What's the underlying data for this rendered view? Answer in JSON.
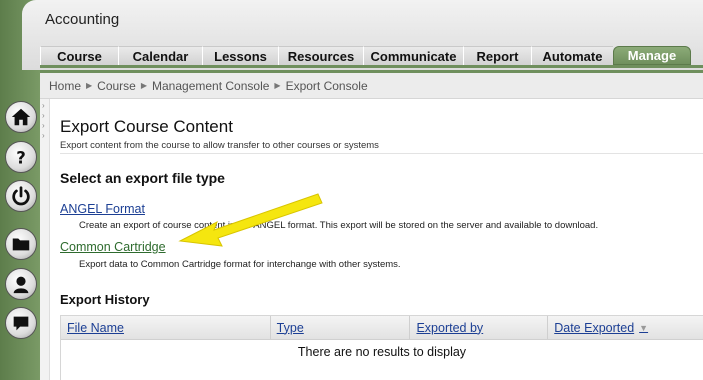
{
  "header": {
    "course_title": "Accounting"
  },
  "tabs": [
    {
      "label": "Course"
    },
    {
      "label": "Calendar"
    },
    {
      "label": "Lessons"
    },
    {
      "label": "Resources"
    },
    {
      "label": "Communicate"
    },
    {
      "label": "Report"
    },
    {
      "label": "Automate"
    },
    {
      "label": "Manage",
      "active": true
    }
  ],
  "breadcrumb": [
    "Home",
    "Course",
    "Management Console",
    "Export Console"
  ],
  "nav_icons": [
    "home-icon",
    "help-icon",
    "power-icon",
    "folder-icon",
    "user-icon",
    "chat-icon"
  ],
  "page": {
    "title": "Export Course Content",
    "subtitle": "Export content from the course to allow transfer to other courses or systems"
  },
  "export": {
    "section_title": "Select an export file type",
    "options": [
      {
        "label": "ANGEL Format",
        "description": "Create an export of course content in the ANGEL format. This export will be stored on the server and available to download."
      },
      {
        "label": "Common Cartridge",
        "description": "Export data to Common Cartridge format for interchange with other systems."
      }
    ]
  },
  "history": {
    "section_title": "Export History",
    "columns": [
      "File Name",
      "Type",
      "Exported by",
      "Date Exported"
    ],
    "empty_message": "There are no results to display"
  },
  "colors": {
    "brand_green": "#6f8f5d",
    "link_blue": "#1c3f94",
    "link_green": "#2e6b2e",
    "highlight_arrow": "#f5e60f"
  }
}
